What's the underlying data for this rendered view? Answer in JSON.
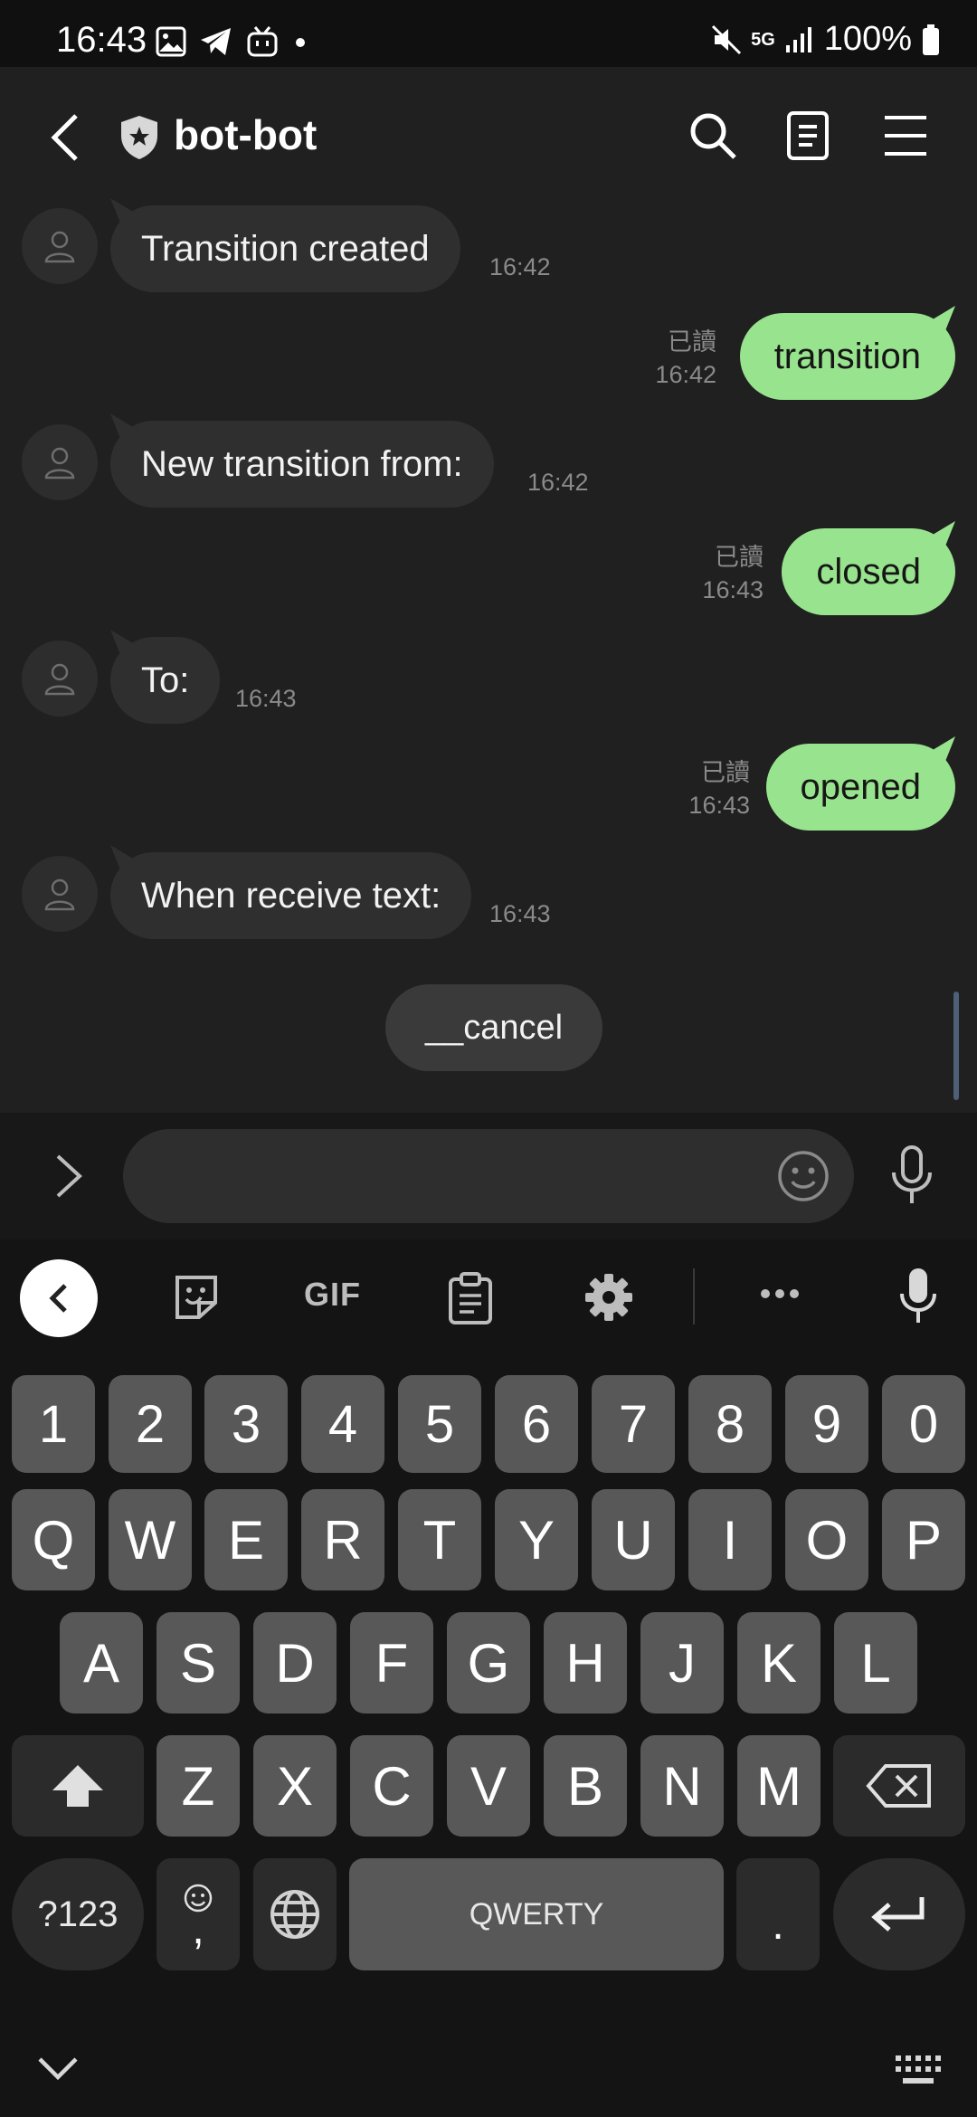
{
  "status_bar": {
    "time": "16:43",
    "network": "5G",
    "battery": "100%",
    "notification_icons": [
      "image-icon",
      "telegram-icon",
      "bilibili-icon",
      "dot-icon"
    ]
  },
  "header": {
    "title": "bot-bot",
    "icons": [
      "back-icon",
      "shield-icon",
      "search-icon",
      "notes-icon",
      "menu-icon"
    ]
  },
  "messages": [
    {
      "direction": "in",
      "text": "Transition created",
      "time": "16:42"
    },
    {
      "direction": "out",
      "text": "transition",
      "read": "已讀",
      "time": "16:42"
    },
    {
      "direction": "in",
      "text": "New transition from:",
      "time": "16:42"
    },
    {
      "direction": "out",
      "text": "closed",
      "read": "已讀",
      "time": "16:43"
    },
    {
      "direction": "in",
      "text": "To:",
      "time": "16:43"
    },
    {
      "direction": "out",
      "text": "opened",
      "read": "已讀",
      "time": "16:43"
    },
    {
      "direction": "in",
      "text": "When receive text:",
      "time": "16:43"
    }
  ],
  "quick_reply": "__cancel",
  "input": {
    "value": "",
    "placeholder": ""
  },
  "keyboard_toolbar": {
    "gif_label": "GIF",
    "icons": [
      "collapse-icon",
      "sticker-icon",
      "clipboard-icon",
      "settings-icon",
      "more-icon",
      "voice-input-icon"
    ]
  },
  "keyboard": {
    "row_numbers": [
      "1",
      "2",
      "3",
      "4",
      "5",
      "6",
      "7",
      "8",
      "9",
      "0"
    ],
    "row1": [
      "Q",
      "W",
      "E",
      "R",
      "T",
      "Y",
      "U",
      "I",
      "O",
      "P"
    ],
    "row2": [
      "A",
      "S",
      "D",
      "F",
      "G",
      "H",
      "J",
      "K",
      "L"
    ],
    "row3": [
      "Z",
      "X",
      "C",
      "V",
      "B",
      "N",
      "M"
    ],
    "symbols_label": "?123",
    "comma_label": ",",
    "space_label": "QWERTY",
    "period_label": "."
  },
  "colors": {
    "outgoing_bubble": "#98e48e",
    "incoming_bubble": "#2f2f2f",
    "background": "#202020",
    "key": "#585858"
  }
}
